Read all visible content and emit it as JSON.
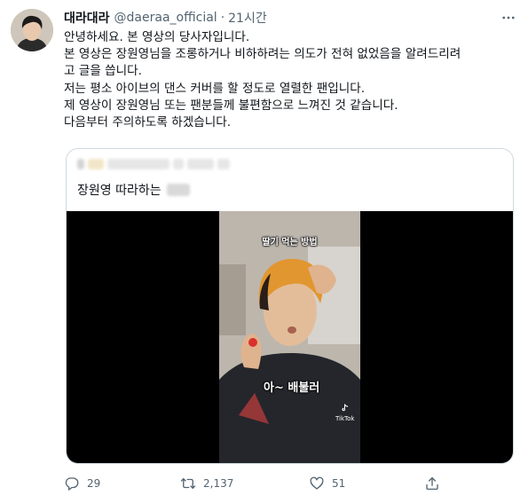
{
  "tweet": {
    "display_name": "대라대라",
    "handle": "@daeraa_official",
    "separator": "·",
    "time": "21시간",
    "body_lines": [
      "안녕하세요. 본 영상의 당사자입니다.",
      "본 영상은 장원영님을 조롱하거나 비하하려는 의도가 전혀 없었음을 알려드리려",
      "고 글을 씁니다.",
      "저는 평소 아이브의 댄스 커버를 할 정도로 열렬한 팬입니다.",
      "제 영상이 장원영님 또는 팬분들께 불편함으로 느껴진 것 같습니다.",
      "다음부터 주의하도록 하겠습니다."
    ]
  },
  "quoted": {
    "text": "장원영 따라하는",
    "video_caption_top": "딸기 먹는 방법",
    "video_caption_mid": "아~ 배불러",
    "video_watermark": "TikTok"
  },
  "actions": {
    "replies": "29",
    "retweets": "2,137",
    "likes": "51"
  },
  "icons": [
    "more-icon",
    "reply-icon",
    "retweet-icon",
    "like-icon",
    "share-icon",
    "tiktok-icon"
  ],
  "colors": {
    "text": "#0f1419",
    "secondary": "#536471",
    "border": "#cfd9de"
  }
}
